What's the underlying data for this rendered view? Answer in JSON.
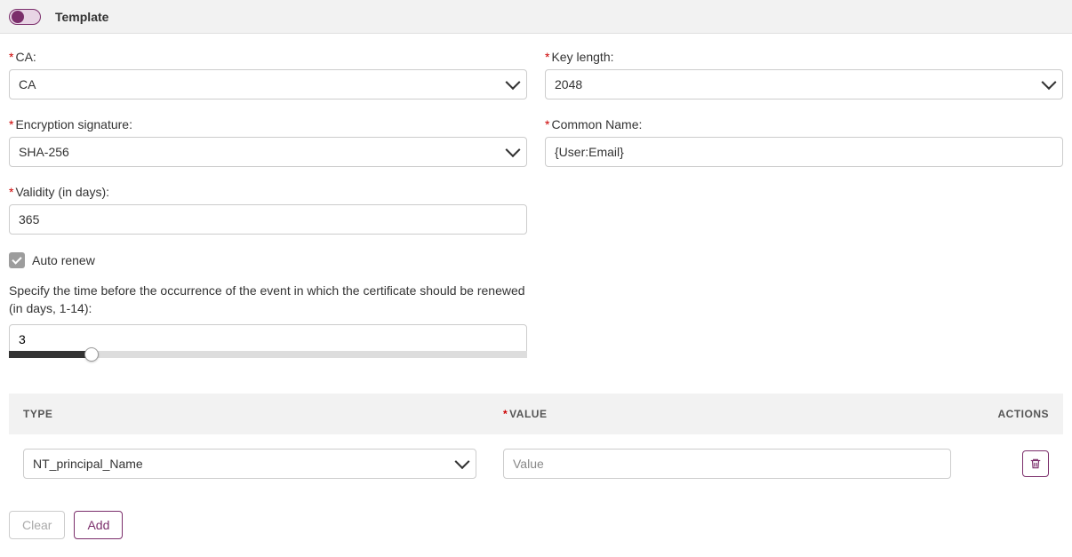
{
  "header": {
    "template_label": "Template",
    "toggle_on": true
  },
  "left": {
    "ca_label": "CA:",
    "ca_value": "CA",
    "enc_label": "Encryption signature:",
    "enc_value": "SHA-256",
    "validity_label": "Validity (in days):",
    "validity_value": "365",
    "autorenew_label": "Auto renew",
    "renew_helper": "Specify the time before the occurrence of the event in which the certificate should be renewed (in days, 1-14):",
    "renew_value": "3"
  },
  "right": {
    "keylen_label": "Key length:",
    "keylen_value": "2048",
    "cn_label": "Common Name:",
    "cn_value": "{User:Email}"
  },
  "table": {
    "header_type": "TYPE",
    "header_value": "VALUE",
    "header_actions": "ACTIONS",
    "rows": [
      {
        "type": "NT_principal_Name",
        "value_placeholder": "Value"
      }
    ]
  },
  "buttons": {
    "clear": "Clear",
    "add": "Add"
  }
}
